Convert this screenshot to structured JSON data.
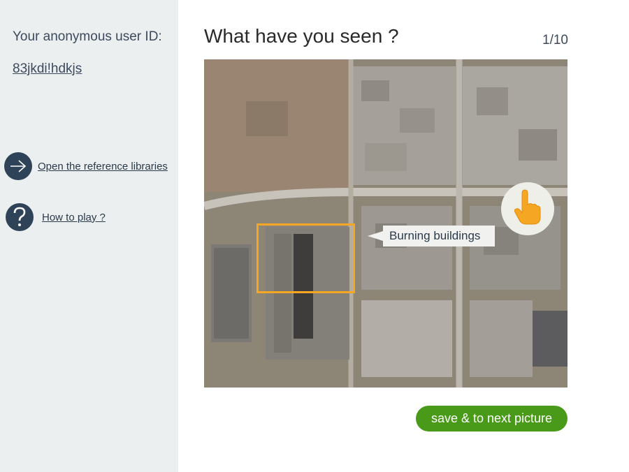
{
  "sidebar": {
    "user_id_label": "Your anonymous user ID:",
    "user_id_value": "83jkdi!hdkjs",
    "links": [
      {
        "label": "Open the reference libraries",
        "icon": "arrow-right-icon"
      },
      {
        "label": "How to play ?",
        "icon": "question-icon"
      }
    ]
  },
  "main": {
    "title": "What have you seen ?",
    "counter": "1/10",
    "annotation_label": "Burning buildings",
    "next_button": "save &  to next picture",
    "tap_icon": "pointing-hand-icon"
  },
  "colors": {
    "sidebar_bg": "#eceff0",
    "accent_green": "#4a9a1a",
    "box_orange": "#f5a623",
    "icon_navy": "#2e4358"
  }
}
